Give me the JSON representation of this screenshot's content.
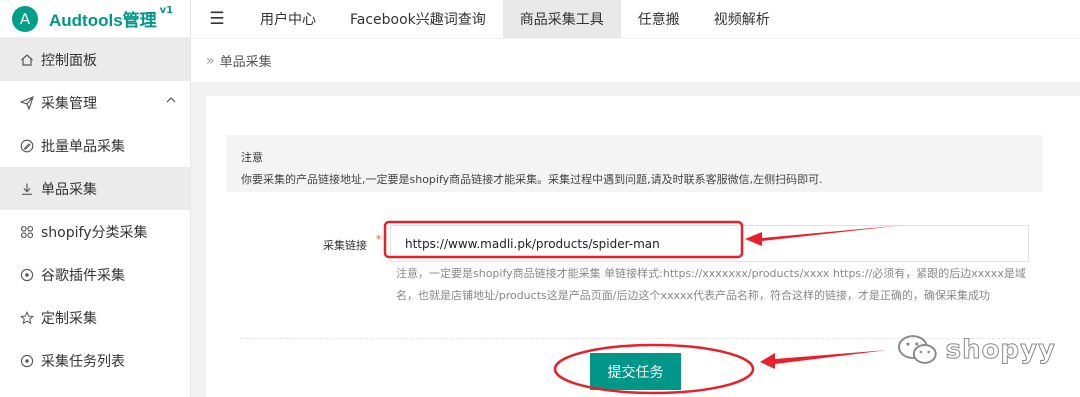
{
  "brand": {
    "logo_letter": "A",
    "title": "Audtools管理",
    "version": "v1"
  },
  "sidebar": {
    "items": [
      {
        "label": "控制面板",
        "icon": "home-icon"
      },
      {
        "label": "采集管理",
        "icon": "send-icon"
      },
      {
        "label": "批量单品采集",
        "icon": "edit-circle-icon"
      },
      {
        "label": "单品采集",
        "icon": "download-icon"
      },
      {
        "label": "shopify分类采集",
        "icon": "grid-icon"
      },
      {
        "label": "谷歌插件采集",
        "icon": "radio-icon"
      },
      {
        "label": "定制采集",
        "icon": "star-icon"
      },
      {
        "label": "采集任务列表",
        "icon": "radio-icon"
      }
    ]
  },
  "topbar": {
    "menu_icon": "☰",
    "tabs": [
      "用户中心",
      "Facebook兴趣词查询",
      "商品采集工具",
      "任意搬",
      "视频解析"
    ]
  },
  "breadcrumb": {
    "current": "单品采集"
  },
  "notice": {
    "title": "注意",
    "text": "你要采集的产品链接地址,一定要是shopify商品链接才能采集。采集过程中遇到问题,请及时联系客服微信,左侧扫码即可."
  },
  "form": {
    "label": "采集链接",
    "required_mark": "*",
    "value": "https://www.madli.pk/products/spider-man",
    "hint": "注意，一定要是shopify商品链接才能采集 单链接样式:https://xxxxxxx/products/xxxx https://必须有，紧跟的后边xxxxx是域名，也就是店铺地址/products这是产品页面/后边这个xxxxx代表产品名称，符合这样的链接，才是正确的，确保采集成功",
    "submit_label": "提交任务"
  },
  "watermark": {
    "text": "shopyy",
    "icon": "wechat-icon"
  },
  "colors": {
    "accent": "#009688",
    "annotation": "#e8202a"
  }
}
